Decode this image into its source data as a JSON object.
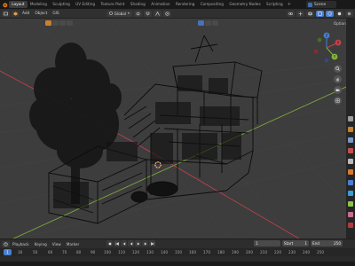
{
  "workspace_tabs": [
    "Layout",
    "Modeling",
    "Sculpting",
    "UV Editing",
    "Texture Paint",
    "Shading",
    "Animation",
    "Rendering",
    "Compositing",
    "Geometry Nodes",
    "Scripting"
  ],
  "active_tab": "Layout",
  "scene": {
    "name": "Scene"
  },
  "header": {
    "mode_label": "",
    "menus": [
      "Add",
      "Object",
      "GIS"
    ],
    "transform_orientation": "Global"
  },
  "viewport": {
    "options_label": "Options",
    "gizmo_axes": [
      "X",
      "Y",
      "Z"
    ]
  },
  "timeline": {
    "menus": [
      "Playback",
      "Keying",
      "View",
      "Marker"
    ],
    "current_frame": "1",
    "start_label": "Start",
    "start_value": "1",
    "end_label": "End",
    "end_value": "250",
    "ruler_ticks": [
      "0",
      "30",
      "50",
      "60",
      "70",
      "80",
      "90",
      "100",
      "110",
      "120",
      "130",
      "140",
      "150",
      "160",
      "170",
      "180",
      "190",
      "200",
      "210",
      "220",
      "230",
      "240",
      "250"
    ]
  },
  "colors": {
    "x_axis": "#c4414e",
    "y_axis": "#83b43a",
    "z_axis": "#4a7fd0",
    "accent": "#4a7fd0"
  }
}
